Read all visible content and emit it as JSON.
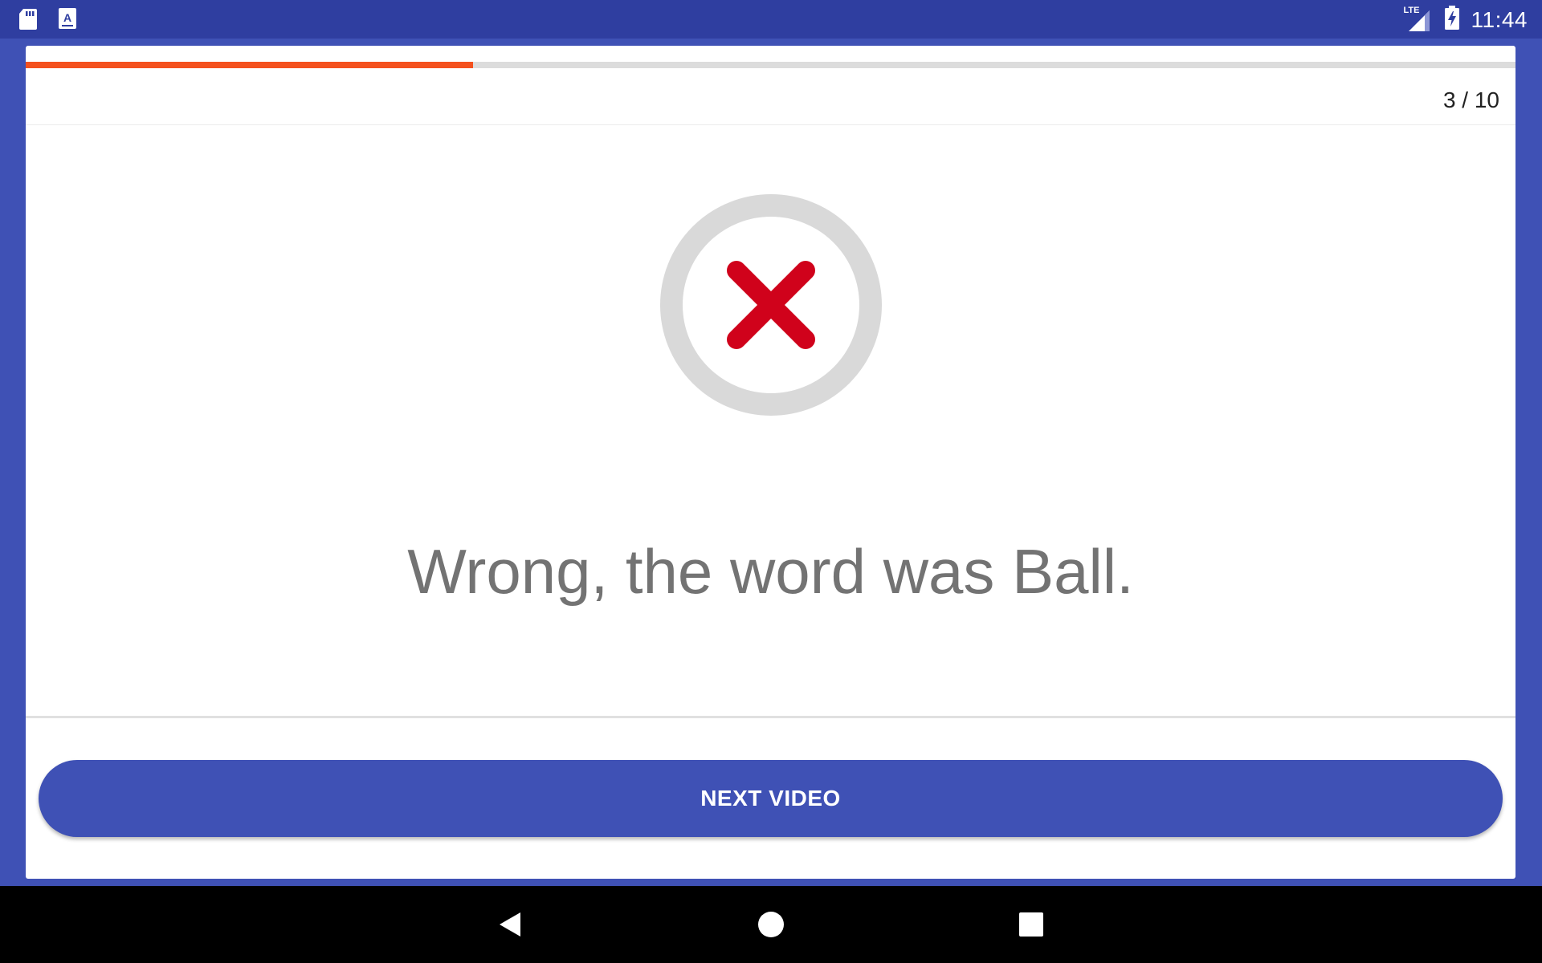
{
  "status_bar": {
    "left_icons": [
      "sd-card-icon",
      "app-notification-icon"
    ],
    "network_label": "LTE",
    "time": "11:44"
  },
  "quiz": {
    "progress": 0.3,
    "counter": "3 / 10",
    "progress_color": "#f4511e",
    "result_icon": "wrong-x-icon",
    "result_color": "#d0021b",
    "message": "Wrong, the word was Ball.",
    "next_button_label": "NEXT VIDEO"
  },
  "colors": {
    "primary": "#3f51b5",
    "status_bar": "#2f3ea0"
  },
  "navigation_bar": {
    "buttons": [
      "back-icon",
      "home-icon",
      "recents-icon"
    ]
  }
}
